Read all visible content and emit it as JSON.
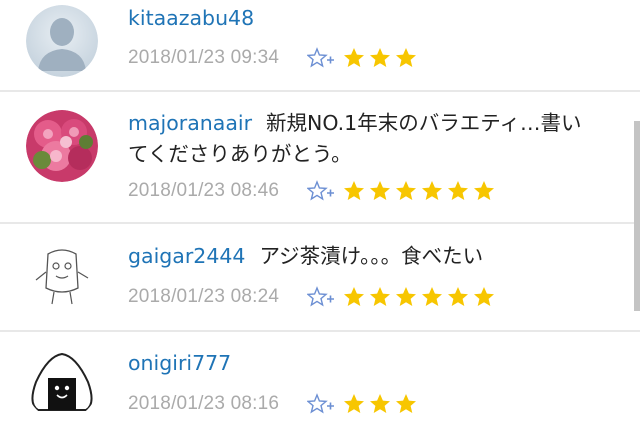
{
  "comments": [
    {
      "username": "kitaazabu48",
      "text": "",
      "text2": "",
      "date": "2018/01/23 09:34",
      "rating": 3,
      "avatar": "default-person-icon"
    },
    {
      "username": "majoranaair",
      "text": "新規NO.1年末のバラエティ…書い",
      "text2": "てくださりありがとう。",
      "date": "2018/01/23 08:46",
      "rating": 6,
      "avatar": "rose-photo"
    },
    {
      "username": "gaigar2444",
      "text": "アジ茶漬け。。。食べたい",
      "text2": "",
      "date": "2018/01/23 08:24",
      "rating": 6,
      "avatar": "doodle-character"
    },
    {
      "username": "onigiri777",
      "text": "",
      "text2": "",
      "date": "2018/01/23 08:16",
      "rating": 3,
      "avatar": "onigiri-icon"
    }
  ],
  "colors": {
    "username": "#1f74b6",
    "star": "#f7c600",
    "fav_icon": "#6c8fd3",
    "date": "#aaaaaa"
  }
}
